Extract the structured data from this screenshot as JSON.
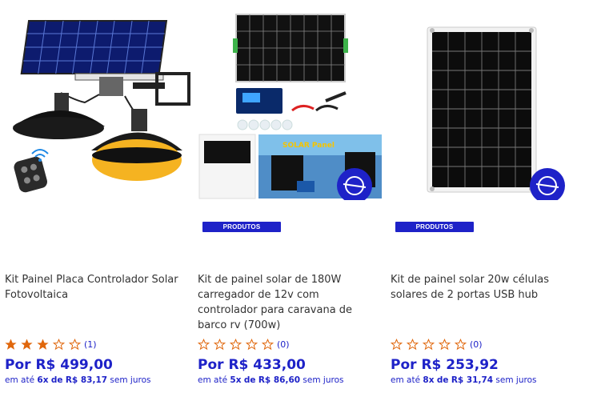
{
  "products": [
    {
      "title": "Kit Painel Placa Controlador Solar Fotovoltaica",
      "badge": "",
      "rating_stars": 3,
      "rating_count": "(1)",
      "price": "Por R$ 499,00",
      "installment": {
        "prefix": "em até",
        "count": "6x",
        "middle": "de",
        "value": "R$ 83,17",
        "suffix": "sem juros"
      },
      "image_icon": "solar-pendant-lamp-image"
    },
    {
      "title": "Kit de painel solar de 180W carregador de 12v com controlador para caravana de barco rv (700w)",
      "badge": "PRODUTOS",
      "rating_stars": 0,
      "rating_count": "(0)",
      "price": "Por R$ 433,00",
      "installment": {
        "prefix": "em até",
        "count": "5x",
        "middle": "de",
        "value": "R$ 86,60",
        "suffix": "sem juros"
      },
      "image_icon": "solar-panel-kit-image"
    },
    {
      "title": "Kit de painel solar 20w células solares de 2 portas USB hub",
      "badge": "PRODUTOS",
      "rating_stars": 0,
      "rating_count": "(0)",
      "price": "Por R$ 253,92",
      "installment": {
        "prefix": "em até",
        "count": "8x",
        "middle": "de",
        "value": "R$ 31,74",
        "suffix": "sem juros"
      },
      "image_icon": "solar-panel-image"
    }
  ],
  "colors": {
    "accent": "#1e22c8",
    "star": "#e0670c",
    "badge": "#1e22c8"
  }
}
